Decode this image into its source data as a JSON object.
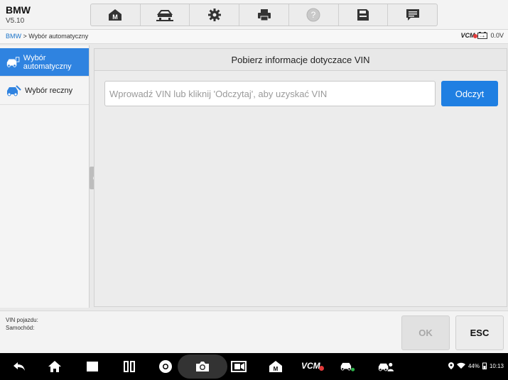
{
  "header": {
    "title": "BMW",
    "version": "V5.10",
    "toolbar": [
      {
        "name": "home-m-icon"
      },
      {
        "name": "vehicle-lift-icon"
      },
      {
        "name": "settings-gear-icon"
      },
      {
        "name": "printer-icon"
      },
      {
        "name": "help-icon"
      },
      {
        "name": "save-icon"
      },
      {
        "name": "message-icon"
      }
    ]
  },
  "breadcrumb": {
    "root": "BMW",
    "separator": " > ",
    "current": "Wybór automatyczny"
  },
  "status": {
    "vcm_label": "VCM",
    "voltage": "0.0V"
  },
  "sidebar": {
    "items": [
      {
        "label": "Wybór automatyczny",
        "active": true,
        "icon": "car-scan-icon"
      },
      {
        "label": "Wybór reczny",
        "active": false,
        "icon": "car-manual-icon"
      }
    ]
  },
  "main": {
    "title": "Pobierz informacje dotyczace VIN",
    "vin_placeholder": "Wprowadź VIN lub kliknij 'Odczytaj', aby uzyskać VIN",
    "vin_value": "",
    "read_button": "Odczyt"
  },
  "footer": {
    "vin_label": "VIN pojazdu:",
    "car_label": "Samochód:",
    "ok_button": "OK",
    "esc_button": "ESC"
  },
  "navbar": {
    "vcm_label": "VCM",
    "battery": "44%",
    "time": "10:13"
  },
  "colors": {
    "accent": "#2f83e0",
    "button_blue": "#1f7fe2",
    "alert_red": "#e23b3b"
  }
}
